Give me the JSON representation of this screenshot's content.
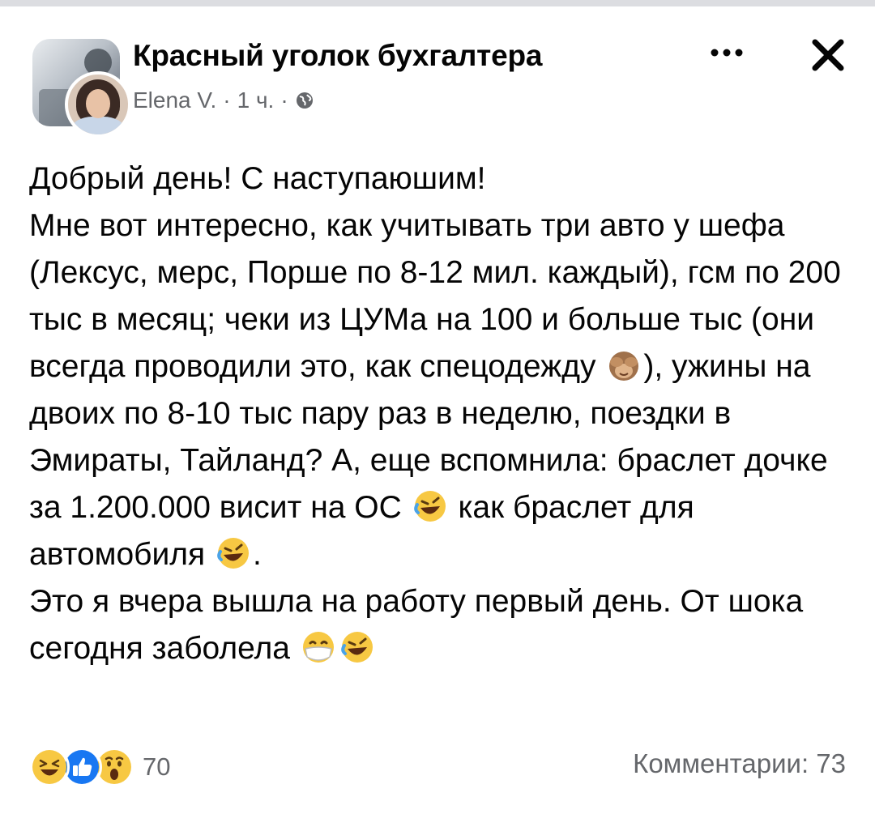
{
  "post": {
    "group_name": "Красный уголок бухгалтера",
    "author": "Elena V.",
    "time": "1 ч.",
    "separator": "·",
    "icons": {
      "privacy": "globe-icon",
      "menu": "more-icon",
      "close": "close-icon"
    },
    "body": {
      "lines": [
        "Добрый день! С наступаюшим!",
        "Мне вот интересно, как учитывать три авто у шефа (Лексус, мерс, Порше по 8-12 мил. каждый), гсм по 200 тыс в месяц; чеки из ЦУМа на 100 и больше тыс (они всегда проводили это, как спецодежду",
        "), ужины на двоих по 8-10 тыс пару раз в неделю, поездки в Эмираты, Тайланд? А, еще вспомнила: браслет дочке за 1.200.000 висит на ОС",
        "как браслет для автомобиля",
        ".",
        "Это я вчера вышла на работу первый день. От шока сегодня заболела"
      ],
      "emojis": [
        "see-no-evil-monkey",
        "rolling-laughing",
        "rolling-laughing",
        "face-with-medical-mask",
        "rolling-laughing"
      ]
    },
    "reactions": {
      "types": [
        "haha",
        "like",
        "wow"
      ],
      "count": "70"
    },
    "comments_label": "Комментарии: 73",
    "colors": {
      "text": "#050505",
      "secondary": "#65676b",
      "like_blue": "#1877f2",
      "emoji_yellow": "#f7c843"
    }
  }
}
